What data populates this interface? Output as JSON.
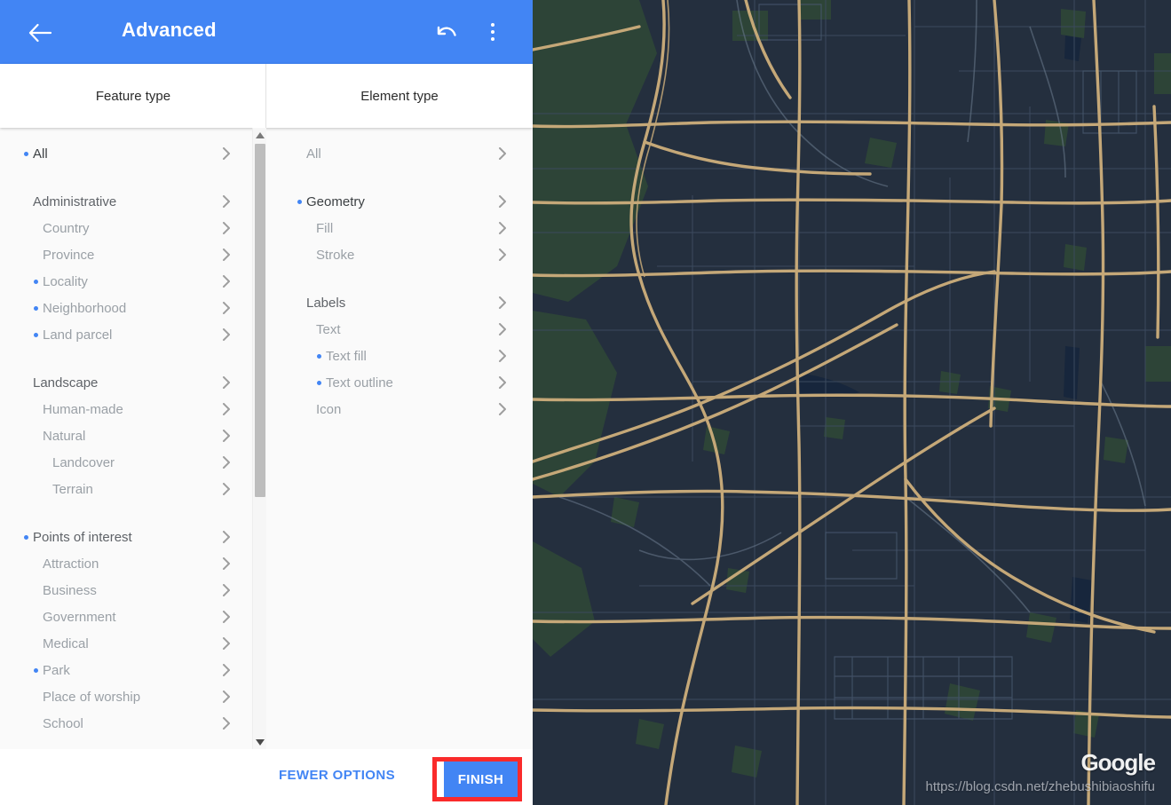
{
  "header": {
    "title": "Advanced",
    "back_icon": "arrow-left-icon",
    "undo_icon": "undo-icon",
    "menu_icon": "more-vert-icon"
  },
  "tabs": [
    {
      "label": "Feature type",
      "name": "tab-feature-type"
    },
    {
      "label": "Element type",
      "name": "tab-element-type"
    }
  ],
  "feature_type": {
    "items": [
      {
        "label": "All",
        "indent": 0,
        "dot": true,
        "tone": "strong"
      },
      {
        "gap": true
      },
      {
        "label": "Administrative",
        "indent": 0,
        "dot": false,
        "tone": "head"
      },
      {
        "label": "Country",
        "indent": 1,
        "dot": false,
        "tone": "dim"
      },
      {
        "label": "Province",
        "indent": 1,
        "dot": false,
        "tone": "dim"
      },
      {
        "label": "Locality",
        "indent": 1,
        "dot": true,
        "tone": "dim"
      },
      {
        "label": "Neighborhood",
        "indent": 1,
        "dot": true,
        "tone": "dim"
      },
      {
        "label": "Land parcel",
        "indent": 1,
        "dot": true,
        "tone": "dim"
      },
      {
        "gap": true
      },
      {
        "label": "Landscape",
        "indent": 0,
        "dot": false,
        "tone": "head"
      },
      {
        "label": "Human-made",
        "indent": 1,
        "dot": false,
        "tone": "dim"
      },
      {
        "label": "Natural",
        "indent": 1,
        "dot": false,
        "tone": "dim"
      },
      {
        "label": "Landcover",
        "indent": 2,
        "dot": false,
        "tone": "dim"
      },
      {
        "label": "Terrain",
        "indent": 2,
        "dot": false,
        "tone": "dim"
      },
      {
        "gap": true
      },
      {
        "label": "Points of interest",
        "indent": 0,
        "dot": true,
        "tone": "head"
      },
      {
        "label": "Attraction",
        "indent": 1,
        "dot": false,
        "tone": "dim"
      },
      {
        "label": "Business",
        "indent": 1,
        "dot": false,
        "tone": "dim"
      },
      {
        "label": "Government",
        "indent": 1,
        "dot": false,
        "tone": "dim"
      },
      {
        "label": "Medical",
        "indent": 1,
        "dot": false,
        "tone": "dim"
      },
      {
        "label": "Park",
        "indent": 1,
        "dot": true,
        "tone": "dim"
      },
      {
        "label": "Place of worship",
        "indent": 1,
        "dot": false,
        "tone": "dim"
      },
      {
        "label": "School",
        "indent": 1,
        "dot": false,
        "tone": "dim"
      }
    ]
  },
  "element_type": {
    "items": [
      {
        "label": "All",
        "indent": 0,
        "dot": false,
        "tone": "dim"
      },
      {
        "gap": true
      },
      {
        "label": "Geometry",
        "indent": 0,
        "dot": true,
        "tone": "strong"
      },
      {
        "label": "Fill",
        "indent": 1,
        "dot": false,
        "tone": "dim"
      },
      {
        "label": "Stroke",
        "indent": 1,
        "dot": false,
        "tone": "dim"
      },
      {
        "gap": true
      },
      {
        "label": "Labels",
        "indent": 0,
        "dot": false,
        "tone": "head"
      },
      {
        "label": "Text",
        "indent": 1,
        "dot": false,
        "tone": "dim"
      },
      {
        "label": "Text fill",
        "indent": 2,
        "dot": true,
        "tone": "dim"
      },
      {
        "label": "Text outline",
        "indent": 2,
        "dot": true,
        "tone": "dim"
      },
      {
        "label": "Icon",
        "indent": 1,
        "dot": false,
        "tone": "dim"
      }
    ]
  },
  "actions": {
    "fewer_options": "FEWER OPTIONS",
    "finish": "FINISH"
  },
  "map": {
    "attribution": "Google",
    "watermark": "https://blog.csdn.net/zhebushibiaoshifu"
  },
  "colors": {
    "accent": "#4285f4",
    "highlight_box": "#fa2b2b",
    "map_base": "#242f3e",
    "map_road": "#c5a878",
    "map_park": "#2d4437",
    "map_water": "#17263c",
    "panel_bg": "#fafafa"
  }
}
